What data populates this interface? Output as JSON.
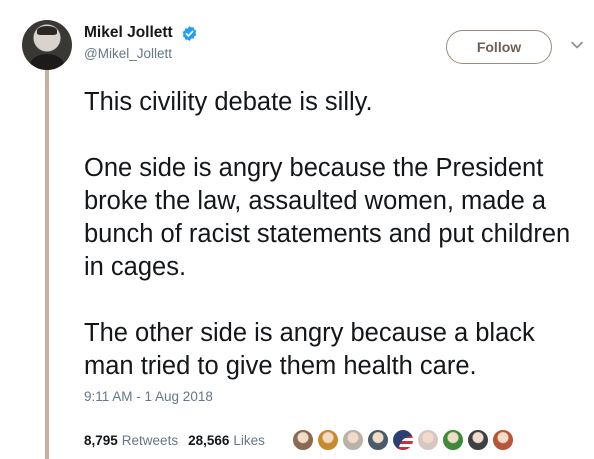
{
  "author": {
    "display_name": "Mikel Jollett",
    "handle": "@Mikel_Jollett",
    "verified": true,
    "avatar_icon": "profile-photo-icon",
    "verified_icon": "verified-badge-icon"
  },
  "actions": {
    "follow_label": "Follow",
    "menu_icon": "chevron-down-icon"
  },
  "tweet": {
    "text": "This civility debate is silly.\n\nOne side is angry because the President broke the law, assaulted women, made a bunch of racist statements and put children in cages.\n\nThe other side is angry because a black man tried to give them health care.",
    "timestamp": "9:11 AM - 1 Aug 2018"
  },
  "stats": {
    "retweets_count": "8,795",
    "retweets_label": "Retweets",
    "likes_count": "28,566",
    "likes_label": "Likes"
  },
  "likers": [
    {
      "icon": "liker-avatar-icon",
      "color": "#8c6a52"
    },
    {
      "icon": "liker-avatar-icon",
      "color": "#c9892f"
    },
    {
      "icon": "liker-avatar-icon",
      "color": "#b9b2a7"
    },
    {
      "icon": "liker-avatar-icon",
      "color": "#4a5a6b"
    },
    {
      "icon": "flag-avatar-icon",
      "color": "#c0343b"
    },
    {
      "icon": "liker-avatar-icon",
      "color": "#d7c7c2"
    },
    {
      "icon": "liker-avatar-icon",
      "color": "#3f8a3a"
    },
    {
      "icon": "liker-avatar-icon",
      "color": "#3c3f45"
    },
    {
      "icon": "liker-avatar-icon",
      "color": "#b5553a"
    }
  ],
  "colors": {
    "thread_line": "#c6b19d",
    "verified": "#1da1f2",
    "follow_border": "#9b8b7e",
    "secondary_text": "#657786"
  }
}
